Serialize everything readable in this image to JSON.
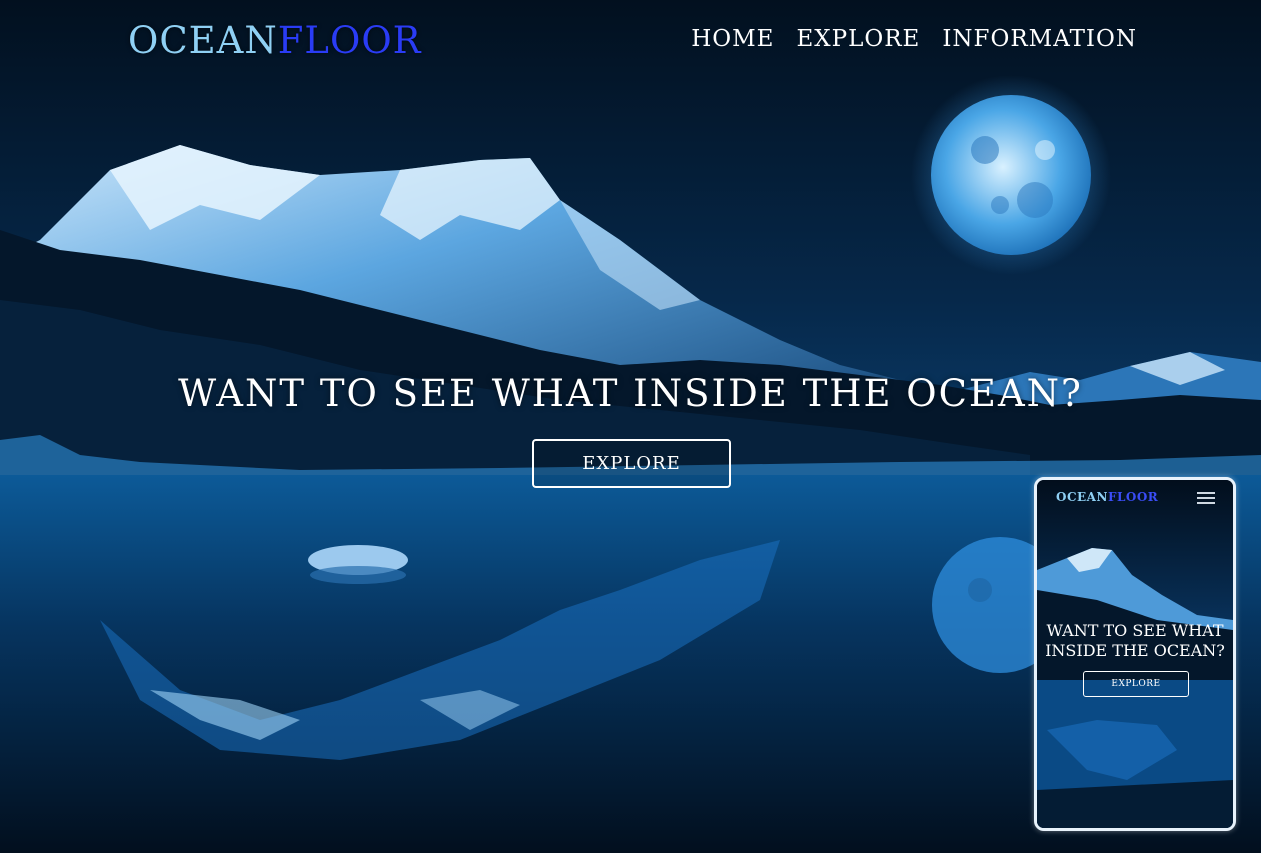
{
  "header": {
    "logo_part1": "OCEAN",
    "logo_part2": "FLOOR",
    "nav": [
      {
        "label": "HOME"
      },
      {
        "label": "EXPLORE"
      },
      {
        "label": "INFORMATION"
      }
    ]
  },
  "hero": {
    "title": "WANT TO SEE WHAT INSIDE THE OCEAN?",
    "button_label": "EXPLORE"
  },
  "mobile_preview": {
    "logo_part1": "OCEAN",
    "logo_part2": "FLOOR",
    "menu_icon": "hamburger-menu-icon",
    "title": "WANT TO SEE WHAT INSIDE THE OCEAN?",
    "button_label": "EXPLORE"
  },
  "colors": {
    "logo_primary": "#8fd0f4",
    "logo_accent": "#2a3cf5",
    "background_dark": "#041a33",
    "water": "#0b4f8c",
    "snow": "#d8ecfb",
    "moon": "#a9dcfa"
  }
}
